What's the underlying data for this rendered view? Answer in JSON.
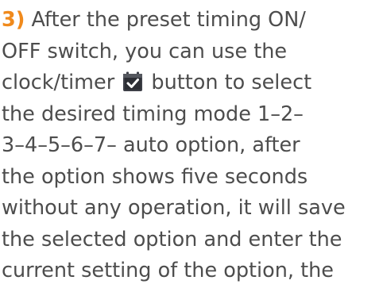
{
  "instruction": {
    "step_number": "3)",
    "lines": [
      " After the preset timing ON/",
      "OFF switch, you can use the",
      "clock/timer",
      " button to select",
      "the desired timing mode 1–2–",
      "3–4–5–6–7– auto option, after",
      "the option shows five seconds",
      "without any operation, it will save",
      "the selected option and enter the",
      "current setting of the option, the"
    ],
    "icon": "calendar-check-icon",
    "colors": {
      "text": "#4d4d4d",
      "step_number": "#f08a1c",
      "icon_bg": "#3d3f47",
      "icon_check": "#ffffff"
    }
  }
}
